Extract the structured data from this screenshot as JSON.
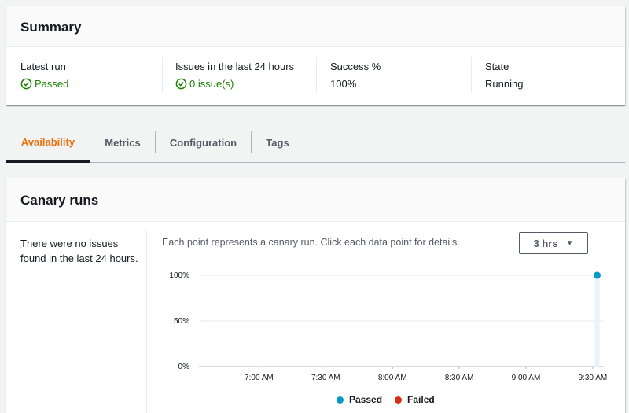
{
  "summary": {
    "title": "Summary",
    "latest_run": {
      "label": "Latest run",
      "value": "Passed"
    },
    "issues": {
      "label": "Issues in the last 24 hours",
      "value": "0 issue(s)"
    },
    "success": {
      "label": "Success %",
      "value": "100%"
    },
    "state": {
      "label": "State",
      "value": "Running"
    }
  },
  "tabs": [
    {
      "label": "Availability",
      "active": true
    },
    {
      "label": "Metrics",
      "active": false
    },
    {
      "label": "Configuration",
      "active": false
    },
    {
      "label": "Tags",
      "active": false
    }
  ],
  "canary": {
    "title": "Canary runs",
    "side_note": "There were no issues found in the last 24 hours.",
    "description": "Each point represents a canary run. Click each data point for details.",
    "range": "3 hrs"
  },
  "colors": {
    "accent": "#ec7211",
    "success": "#1d8102",
    "passed": "#0a9ac7",
    "failed": "#d13212"
  },
  "chart_data": {
    "type": "scatter",
    "title": "",
    "xlabel": "",
    "ylabel": "",
    "y_ticks": [
      "100%",
      "50%",
      "0%"
    ],
    "x_ticks": [
      "7:00 AM",
      "7:30 AM",
      "8:00 AM",
      "8:30 AM",
      "9:00 AM",
      "9:30 AM"
    ],
    "ylim": [
      0,
      100
    ],
    "xlim": [
      "6:33 AM",
      "9:35 AM"
    ],
    "legend_position": "bottom",
    "grid": true,
    "series": [
      {
        "name": "Passed",
        "color": "#0a9ac7",
        "points": [
          {
            "x": "9:32 AM",
            "y": 100
          }
        ]
      },
      {
        "name": "Failed",
        "color": "#d13212",
        "points": []
      }
    ]
  }
}
